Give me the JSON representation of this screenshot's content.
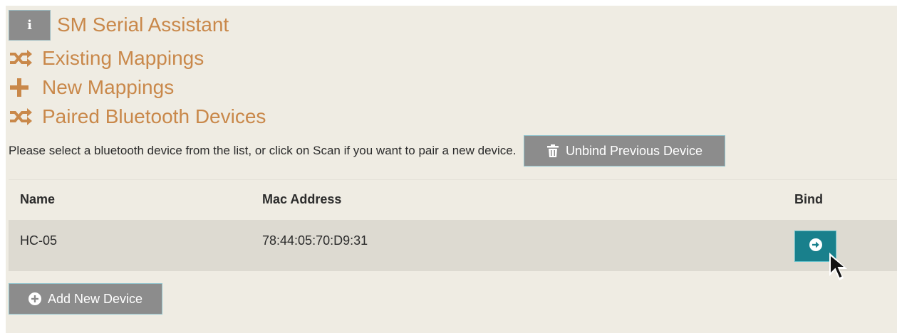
{
  "header": {
    "info_glyph": "i",
    "title": "SM Serial Assistant"
  },
  "nav": {
    "existing_mappings": "Existing Mappings",
    "new_mappings": "New Mappings",
    "paired_devices": "Paired Bluetooth Devices"
  },
  "instructions": {
    "text": "Please select a bluetooth device from the list, or click on Scan if you want to pair a new device.",
    "unbind_label": "Unbind Previous Device"
  },
  "table": {
    "columns": [
      "Name",
      "Mac Address",
      "Bind"
    ],
    "rows": [
      {
        "name": "HC-05",
        "mac": "78:44:05:70:D9:31"
      }
    ]
  },
  "actions": {
    "add_label": "Add New Device"
  },
  "colors": {
    "accent": "#c9884a",
    "primary": "#19808c",
    "button_gray": "#8c8c8c",
    "background": "#efece3"
  },
  "icons": {
    "info": "info-icon",
    "shuffle": "shuffle-icon",
    "plus": "plus-icon",
    "trash": "trash-icon",
    "arrow_circle": "arrow-circle-right-icon",
    "plus_circle": "plus-circle-icon"
  }
}
